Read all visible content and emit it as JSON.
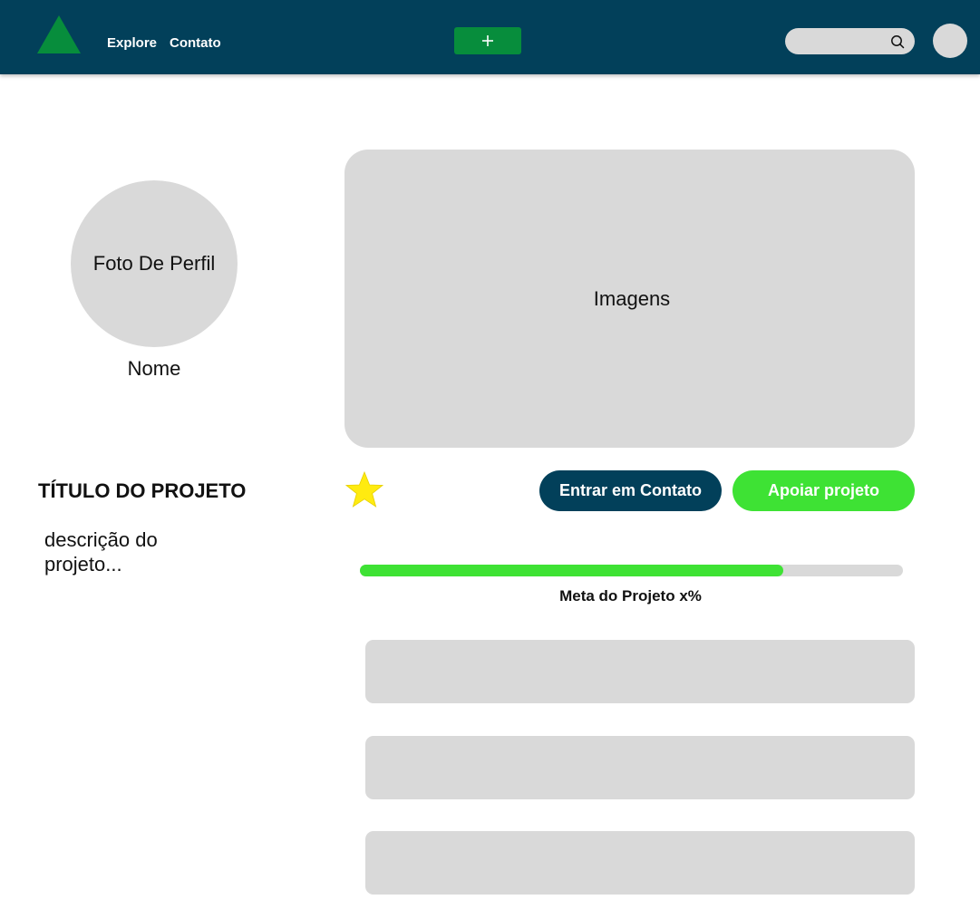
{
  "header": {
    "logo_icon": "triangle-logo-icon",
    "nav": [
      {
        "label": "Explore"
      },
      {
        "label": "Contato"
      }
    ],
    "add_button": {
      "icon": "plus-icon",
      "label": "+"
    },
    "search": {
      "placeholder": "",
      "icon": "search-icon"
    },
    "avatar_icon": "user-avatar"
  },
  "profile": {
    "photo_label": "Foto De Perfil",
    "name": "Nome"
  },
  "gallery": {
    "label": "Imagens"
  },
  "project": {
    "title": "TÍTULO DO PROJETO",
    "description": "descrição do projeto..."
  },
  "actions": {
    "favorite_icon": "star-icon",
    "contact_label": "Entrar em Contato",
    "support_label": "Apoiar projeto"
  },
  "progress": {
    "fraction": 0.78,
    "label": "Meta do Projeto x%"
  },
  "colors": {
    "header_bg": "#02405a",
    "logo": "#078d3c",
    "accent_green": "#3ee234",
    "placeholder_gray": "#d9d9d9",
    "star": "#ffeb10"
  }
}
